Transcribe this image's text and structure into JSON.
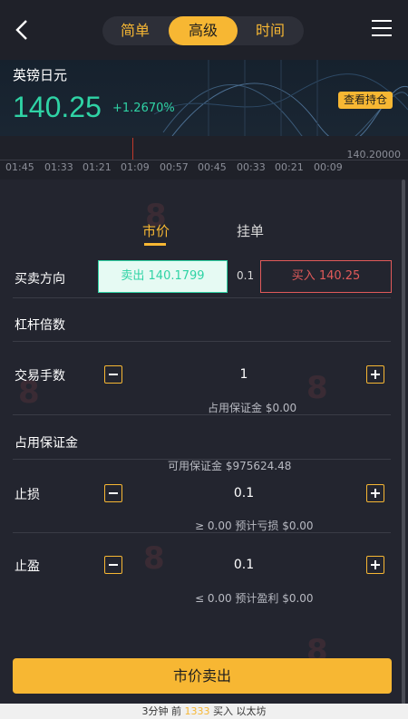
{
  "header": {
    "tabs": [
      {
        "label": "简单",
        "active": false
      },
      {
        "label": "高级",
        "active": true
      },
      {
        "label": "时间",
        "active": false
      }
    ]
  },
  "banner": {
    "pair_name": "英镑日元",
    "price": "140.25",
    "change": "+1.2670%",
    "holdings_label": "查看持仓"
  },
  "timeline": {
    "price_label": "140.20000",
    "labels": [
      "01:45",
      "01:33",
      "01:21",
      "01:09",
      "00:57",
      "00:45",
      "00:33",
      "00:21",
      "00:09"
    ]
  },
  "order": {
    "tabs": [
      {
        "label": "市价",
        "active": true
      },
      {
        "label": "挂单",
        "active": false
      }
    ],
    "direction_label": "买卖方向",
    "sell_label": "卖出 140.1799",
    "spread": "0.1",
    "buy_label": "买入 140.25",
    "leverage_label": "杠杆倍数",
    "lots_label": "交易手数",
    "lots_value": "1",
    "lots_margin_hint": "占用保证金 $0.00",
    "margin_label": "占用保证金",
    "available_margin_hint": "可用保证金 $975624.48",
    "stop_loss_label": "止损",
    "stop_loss_value": "0.1",
    "stop_loss_hint": "≥ 0.00 预计亏损 $0.00",
    "take_profit_label": "止盈",
    "take_profit_value": "0.1",
    "take_profit_hint": "≤ 0.00 预计盈利 $0.00",
    "submit_label": "市价卖出"
  },
  "footer": {
    "prefix": "3分钟 前",
    "highlight": "1333",
    "suffix": "买入 以太坊"
  },
  "colors": {
    "accent": "#f7b733",
    "up": "#2fd3a5",
    "down": "#e15a5a",
    "background": "#23252f"
  },
  "icons": [
    "chevron-left-icon",
    "menu-icon",
    "minus-icon",
    "plus-icon"
  ]
}
